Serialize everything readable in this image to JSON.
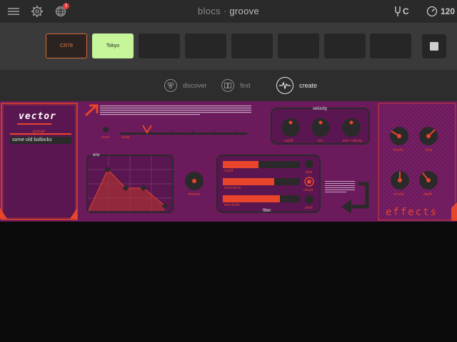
{
  "app": {
    "title_prefix": "blocs",
    "title_sep": "·",
    "title_suffix": "groove"
  },
  "topbar": {
    "menu_icon": "hamburger-icon",
    "settings_icon": "gear-icon",
    "network_icon": "globe-icon",
    "notification_badge": "!",
    "key": "C",
    "tempo": "120"
  },
  "pads": [
    {
      "label": "CR78"
    },
    {
      "label": "Tokyo"
    },
    {
      "label": ""
    },
    {
      "label": ""
    },
    {
      "label": ""
    },
    {
      "label": ""
    },
    {
      "label": ""
    },
    {
      "label": ""
    }
  ],
  "nav": {
    "discover": "discover",
    "find": "find",
    "create": "create"
  },
  "synth": {
    "name": "vector",
    "preset_label": "preset",
    "preset_value": "some old bollocks",
    "slider_left": "reset",
    "slider_right": "scale",
    "env_label": "env",
    "env_knob_label": "amount",
    "velocity_title": "velocity",
    "velocity_knobs": [
      "cutoff",
      "res",
      "env + decay"
    ],
    "filter_title": "filter",
    "filter_bars": [
      "cutoff",
      "resonance",
      "env depth"
    ],
    "filter_side_labels": [
      "type",
      "circuit",
      "drive"
    ],
    "effects_title": "effects",
    "effects_knobs": [
      "reverb",
      "time",
      "reverb",
      "depth"
    ],
    "colors": {
      "bg": "#6b1a5c",
      "accent": "#e8452a",
      "dark": "#2a2a2a"
    }
  }
}
